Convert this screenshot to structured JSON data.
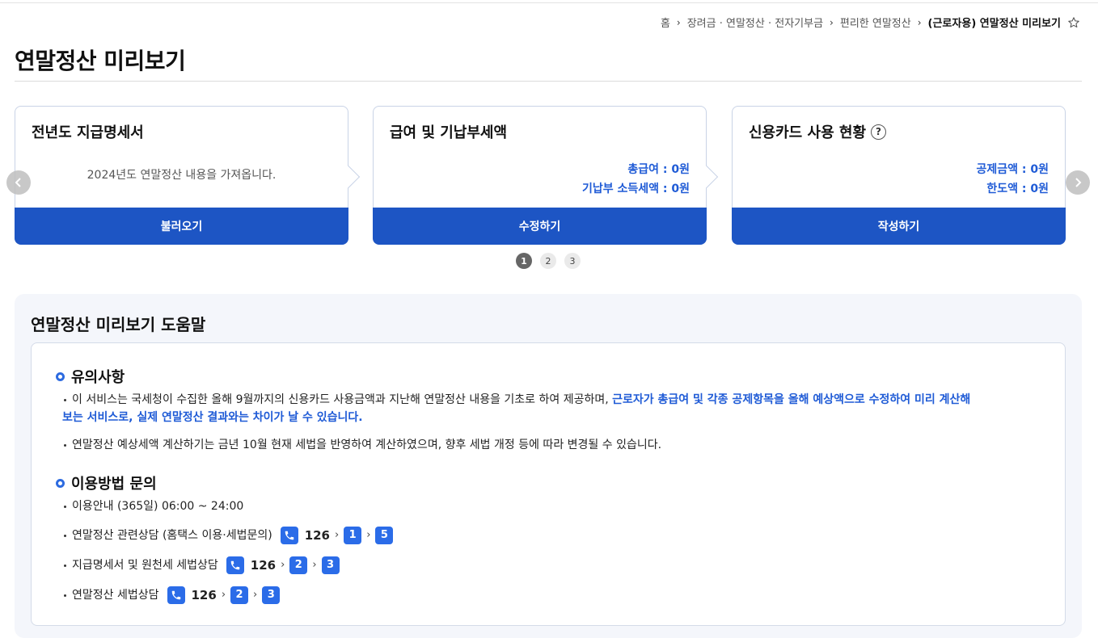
{
  "breadcrumb": {
    "items": [
      "홈",
      "장려금 · 연말정산 · 전자기부금",
      "편리한 연말정산"
    ],
    "current": "(근로자용) 연말정산 미리보기"
  },
  "page": {
    "title": "연말정산 미리보기"
  },
  "cards": [
    {
      "title": "전년도 지급명세서",
      "desc": "2024년도 연말정산 내용을 가져옵니다.",
      "button": "불러오기"
    },
    {
      "title": "급여 및 기납부세액",
      "line1": "총급여 : 0원",
      "line2": "기납부 소득세액 : 0원",
      "button": "수정하기"
    },
    {
      "title": "신용카드 사용 현황",
      "help": "?",
      "line1": "공제금액 : 0원",
      "line2": "한도액 : 0원",
      "button": "작성하기"
    }
  ],
  "pager": [
    "1",
    "2",
    "3"
  ],
  "help": {
    "title": "연말정산 미리보기 도움말",
    "section1": {
      "title": "유의사항",
      "bullet1_plain": "이 서비스는 국세청이 수집한 올해 9월까지의 신용카드 사용금액과 지난해 연말정산 내용을 기초로 하여 제공하며, ",
      "bullet1_hl_a": "근로자가 총급여 및 각종 공제항목을 올해 예상액으로 수정하여 미리 계산해",
      "bullet1_hl_b": "보는 서비스로, 실제 연말정산 결과와는 차이가 날 수 있습니다.",
      "bullet2": "연말정산 예상세액 계산하기는 금년 10월 현재 세법을 반영하여 계산하였으며, 향후 세법 개정 등에 따라 변경될 수 있습니다."
    },
    "section2": {
      "title": "이용방법 문의",
      "hours": "이용안내 (365일) 06:00 ~ 24:00",
      "lines": [
        {
          "label": "연말정산 관련상담 (홈택스 이용·세법문의)",
          "number": "126",
          "k1": "1",
          "k2": "5"
        },
        {
          "label": "지급명세서 및 원천세 세법상담",
          "number": "126",
          "k1": "2",
          "k2": "3"
        },
        {
          "label": "연말정산 세법상담",
          "number": "126",
          "k1": "2",
          "k2": "3"
        }
      ]
    }
  }
}
